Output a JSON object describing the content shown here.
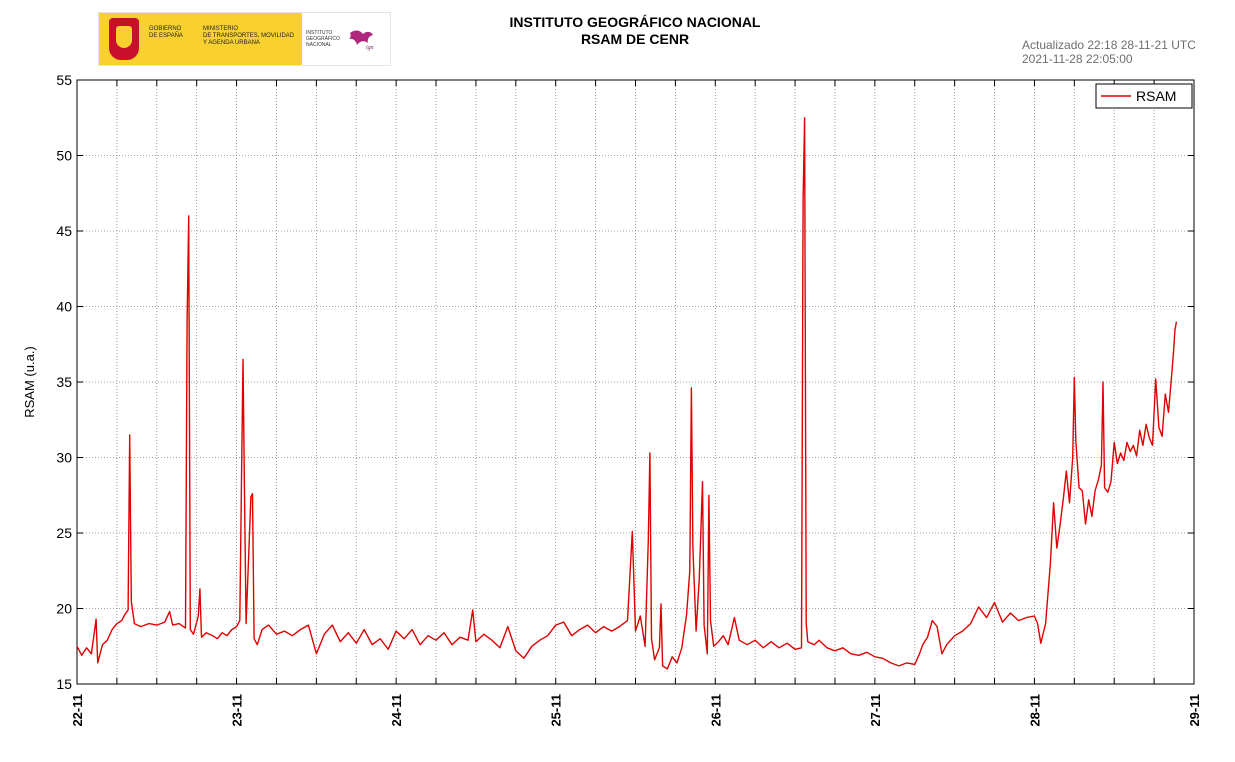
{
  "header": {
    "logo_text": {
      "gobierno": "GOBIERNO\nDE ESPAÑA",
      "ministerio": "MINISTERIO\nDE TRANSPORTES, MOVILIDAD\nY AGENDA URBANA",
      "instituto": "INSTITUTO\nGEOGRÁFICO\nNACIONAL",
      "brand": "ign"
    },
    "title_line1": "INSTITUTO GEOGRÁFICO NACIONAL",
    "title_line2": "RSAM DE CENR",
    "updated_line1": "Actualizado 22:18 28-11-21 UTC",
    "updated_line2": "2021-11-28 22:05:00"
  },
  "chart_data": {
    "type": "line",
    "title": "RSAM DE CENR",
    "xlabel": "",
    "ylabel": "RSAM (u.a.)",
    "x_unit": "days since 22-11",
    "xlim": [
      0,
      7
    ],
    "ylim": [
      15,
      55
    ],
    "y_ticks": [
      15,
      20,
      25,
      30,
      35,
      40,
      45,
      50,
      55
    ],
    "x_ticks": [
      {
        "x": 0,
        "label": "22-11"
      },
      {
        "x": 1,
        "label": "23-11"
      },
      {
        "x": 2,
        "label": "24-11"
      },
      {
        "x": 3,
        "label": "25-11"
      },
      {
        "x": 4,
        "label": "26-11"
      },
      {
        "x": 5,
        "label": "27-11"
      },
      {
        "x": 6,
        "label": "28-11"
      },
      {
        "x": 7,
        "label": "29-11"
      }
    ],
    "minor_x_step": 0.25,
    "grid": true,
    "legend": {
      "position": "top-right",
      "entries": [
        "RSAM"
      ]
    },
    "series": [
      {
        "name": "RSAM",
        "color": "#e00000",
        "points": [
          [
            0.0,
            17.5
          ],
          [
            0.03,
            16.9
          ],
          [
            0.06,
            17.4
          ],
          [
            0.09,
            17.0
          ],
          [
            0.12,
            19.3
          ],
          [
            0.13,
            16.4
          ],
          [
            0.16,
            17.6
          ],
          [
            0.19,
            17.9
          ],
          [
            0.22,
            18.6
          ],
          [
            0.25,
            19.0
          ],
          [
            0.28,
            19.2
          ],
          [
            0.3,
            19.6
          ],
          [
            0.32,
            19.9
          ],
          [
            0.33,
            31.5
          ],
          [
            0.34,
            20.5
          ],
          [
            0.36,
            19.0
          ],
          [
            0.4,
            18.8
          ],
          [
            0.45,
            19.0
          ],
          [
            0.5,
            18.9
          ],
          [
            0.55,
            19.1
          ],
          [
            0.58,
            19.8
          ],
          [
            0.6,
            18.9
          ],
          [
            0.64,
            19.0
          ],
          [
            0.68,
            18.7
          ],
          [
            0.69,
            39.0
          ],
          [
            0.7,
            46.0
          ],
          [
            0.71,
            18.6
          ],
          [
            0.73,
            18.3
          ],
          [
            0.76,
            19.5
          ],
          [
            0.77,
            21.3
          ],
          [
            0.78,
            18.1
          ],
          [
            0.81,
            18.4
          ],
          [
            0.85,
            18.2
          ],
          [
            0.88,
            18.0
          ],
          [
            0.91,
            18.4
          ],
          [
            0.94,
            18.2
          ],
          [
            0.97,
            18.6
          ],
          [
            1.0,
            18.8
          ],
          [
            1.02,
            19.2
          ],
          [
            1.03,
            28.0
          ],
          [
            1.04,
            36.5
          ],
          [
            1.05,
            27.5
          ],
          [
            1.06,
            19.0
          ],
          [
            1.09,
            27.4
          ],
          [
            1.1,
            27.6
          ],
          [
            1.11,
            18.0
          ],
          [
            1.13,
            17.6
          ],
          [
            1.16,
            18.6
          ],
          [
            1.2,
            18.9
          ],
          [
            1.25,
            18.3
          ],
          [
            1.3,
            18.5
          ],
          [
            1.35,
            18.2
          ],
          [
            1.4,
            18.6
          ],
          [
            1.45,
            18.9
          ],
          [
            1.5,
            17.0
          ],
          [
            1.55,
            18.3
          ],
          [
            1.6,
            18.9
          ],
          [
            1.65,
            17.8
          ],
          [
            1.7,
            18.4
          ],
          [
            1.75,
            17.7
          ],
          [
            1.8,
            18.6
          ],
          [
            1.85,
            17.6
          ],
          [
            1.9,
            18.0
          ],
          [
            1.95,
            17.3
          ],
          [
            2.0,
            18.5
          ],
          [
            2.05,
            18.0
          ],
          [
            2.1,
            18.6
          ],
          [
            2.15,
            17.6
          ],
          [
            2.2,
            18.2
          ],
          [
            2.25,
            17.9
          ],
          [
            2.3,
            18.4
          ],
          [
            2.35,
            17.6
          ],
          [
            2.4,
            18.1
          ],
          [
            2.45,
            17.9
          ],
          [
            2.48,
            19.9
          ],
          [
            2.5,
            17.8
          ],
          [
            2.55,
            18.3
          ],
          [
            2.6,
            17.9
          ],
          [
            2.65,
            17.4
          ],
          [
            2.7,
            18.8
          ],
          [
            2.75,
            17.2
          ],
          [
            2.8,
            16.7
          ],
          [
            2.85,
            17.5
          ],
          [
            2.9,
            17.9
          ],
          [
            2.95,
            18.2
          ],
          [
            3.0,
            18.9
          ],
          [
            3.05,
            19.1
          ],
          [
            3.1,
            18.2
          ],
          [
            3.15,
            18.6
          ],
          [
            3.2,
            18.9
          ],
          [
            3.25,
            18.4
          ],
          [
            3.3,
            18.8
          ],
          [
            3.35,
            18.5
          ],
          [
            3.4,
            18.8
          ],
          [
            3.45,
            19.2
          ],
          [
            3.48,
            25.1
          ],
          [
            3.5,
            18.5
          ],
          [
            3.53,
            19.5
          ],
          [
            3.56,
            17.5
          ],
          [
            3.58,
            24.5
          ],
          [
            3.59,
            30.3
          ],
          [
            3.6,
            18.0
          ],
          [
            3.62,
            16.6
          ],
          [
            3.65,
            17.4
          ],
          [
            3.66,
            20.3
          ],
          [
            3.67,
            16.2
          ],
          [
            3.7,
            16.0
          ],
          [
            3.73,
            16.8
          ],
          [
            3.76,
            16.4
          ],
          [
            3.79,
            17.4
          ],
          [
            3.82,
            19.6
          ],
          [
            3.84,
            22.5
          ],
          [
            3.85,
            34.6
          ],
          [
            3.86,
            24.0
          ],
          [
            3.88,
            18.5
          ],
          [
            3.9,
            22.0
          ],
          [
            3.92,
            28.4
          ],
          [
            3.93,
            18.9
          ],
          [
            3.95,
            17.0
          ],
          [
            3.96,
            27.5
          ],
          [
            3.97,
            19.2
          ],
          [
            3.99,
            17.5
          ],
          [
            4.02,
            17.8
          ],
          [
            4.05,
            18.2
          ],
          [
            4.08,
            17.6
          ],
          [
            4.12,
            19.4
          ],
          [
            4.15,
            17.9
          ],
          [
            4.2,
            17.6
          ],
          [
            4.25,
            17.9
          ],
          [
            4.3,
            17.4
          ],
          [
            4.35,
            17.8
          ],
          [
            4.4,
            17.4
          ],
          [
            4.45,
            17.7
          ],
          [
            4.5,
            17.3
          ],
          [
            4.54,
            17.4
          ],
          [
            4.55,
            47.0
          ],
          [
            4.56,
            52.5
          ],
          [
            4.57,
            19.0
          ],
          [
            4.58,
            17.8
          ],
          [
            4.62,
            17.6
          ],
          [
            4.65,
            17.9
          ],
          [
            4.7,
            17.4
          ],
          [
            4.75,
            17.2
          ],
          [
            4.8,
            17.4
          ],
          [
            4.85,
            17.0
          ],
          [
            4.9,
            16.9
          ],
          [
            4.95,
            17.1
          ],
          [
            5.0,
            16.8
          ],
          [
            5.05,
            16.7
          ],
          [
            5.1,
            16.4
          ],
          [
            5.15,
            16.2
          ],
          [
            5.2,
            16.4
          ],
          [
            5.25,
            16.3
          ],
          [
            5.28,
            17.0
          ],
          [
            5.3,
            17.6
          ],
          [
            5.33,
            18.1
          ],
          [
            5.36,
            19.2
          ],
          [
            5.39,
            18.8
          ],
          [
            5.42,
            17.0
          ],
          [
            5.45,
            17.6
          ],
          [
            5.5,
            18.2
          ],
          [
            5.55,
            18.5
          ],
          [
            5.6,
            19.0
          ],
          [
            5.65,
            20.1
          ],
          [
            5.7,
            19.4
          ],
          [
            5.75,
            20.4
          ],
          [
            5.8,
            19.1
          ],
          [
            5.85,
            19.7
          ],
          [
            5.9,
            19.2
          ],
          [
            5.95,
            19.4
          ],
          [
            6.0,
            19.5
          ],
          [
            6.02,
            19.0
          ],
          [
            6.04,
            17.7
          ],
          [
            6.07,
            19.0
          ],
          [
            6.1,
            23.0
          ],
          [
            6.12,
            27.0
          ],
          [
            6.14,
            24.0
          ],
          [
            6.16,
            25.5
          ],
          [
            6.18,
            27.2
          ],
          [
            6.2,
            29.1
          ],
          [
            6.22,
            27.0
          ],
          [
            6.24,
            30.0
          ],
          [
            6.25,
            35.3
          ],
          [
            6.26,
            31.0
          ],
          [
            6.28,
            28.0
          ],
          [
            6.3,
            27.8
          ],
          [
            6.32,
            25.6
          ],
          [
            6.34,
            27.2
          ],
          [
            6.36,
            26.1
          ],
          [
            6.38,
            27.8
          ],
          [
            6.4,
            28.5
          ],
          [
            6.42,
            29.5
          ],
          [
            6.43,
            35.0
          ],
          [
            6.44,
            28.0
          ],
          [
            6.46,
            27.7
          ],
          [
            6.48,
            28.4
          ],
          [
            6.5,
            31.0
          ],
          [
            6.52,
            29.6
          ],
          [
            6.54,
            30.3
          ],
          [
            6.56,
            29.8
          ],
          [
            6.58,
            31.0
          ],
          [
            6.6,
            30.4
          ],
          [
            6.62,
            30.8
          ],
          [
            6.64,
            30.1
          ],
          [
            6.66,
            31.8
          ],
          [
            6.68,
            30.8
          ],
          [
            6.7,
            32.2
          ],
          [
            6.72,
            31.3
          ],
          [
            6.74,
            30.8
          ],
          [
            6.76,
            35.2
          ],
          [
            6.78,
            32.0
          ],
          [
            6.8,
            31.4
          ],
          [
            6.82,
            34.2
          ],
          [
            6.84,
            33.0
          ],
          [
            6.86,
            35.5
          ],
          [
            6.87,
            36.8
          ],
          [
            6.88,
            38.4
          ],
          [
            6.89,
            39.0
          ]
        ]
      }
    ]
  }
}
